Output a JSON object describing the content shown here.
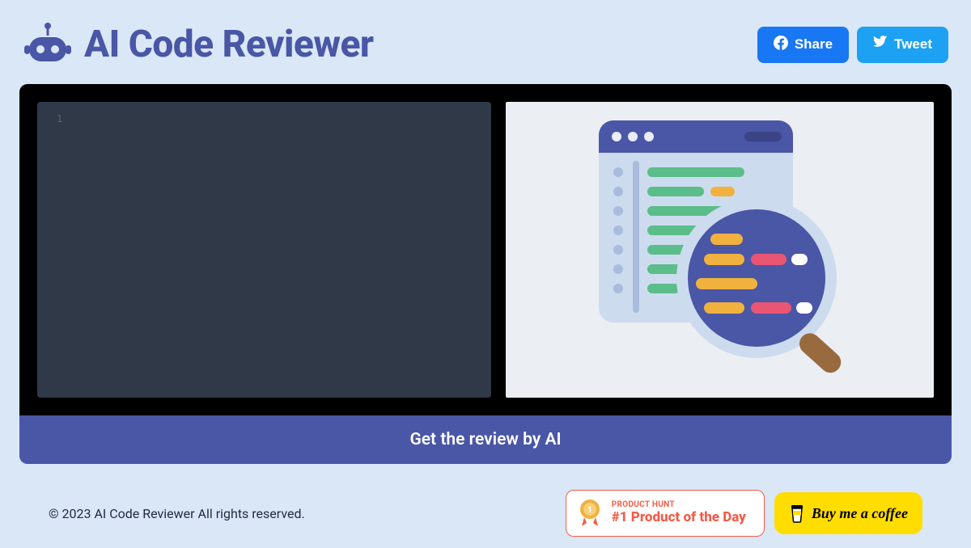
{
  "header": {
    "title": "AI Code Reviewer",
    "share_label": "Share",
    "tweet_label": "Tweet"
  },
  "editor": {
    "line_number": "1",
    "content": ""
  },
  "cta": {
    "label": "Get the review by AI"
  },
  "footer": {
    "copyright": "© 2023 AI Code Reviewer All rights reserved.",
    "product_hunt_small": "PRODUCT HUNT",
    "product_hunt_big": "#1 Product of the Day",
    "bmc_label": "Buy me a coffee"
  },
  "colors": {
    "brand": "#4a56a6",
    "bg": "#dae7f6",
    "fb": "#1877f2",
    "tw": "#1da1f2",
    "ph": "#f75a46",
    "bmc": "#ffdd00"
  }
}
